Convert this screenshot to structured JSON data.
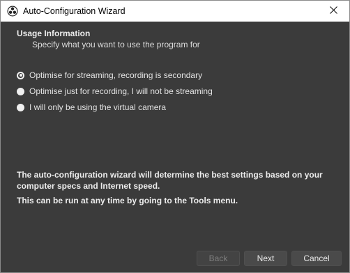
{
  "window": {
    "title": "Auto-Configuration Wizard",
    "icon": "obs-logo-icon",
    "close_icon": "close-icon"
  },
  "usage": {
    "title": "Usage Information",
    "subtitle": "Specify what you want to use the program for",
    "options": [
      {
        "label": "Optimise for streaming, recording is secondary",
        "selected": true
      },
      {
        "label": "Optimise just for recording, I will not be streaming",
        "selected": false
      },
      {
        "label": "I will only be using the virtual camera",
        "selected": false
      }
    ]
  },
  "info": {
    "line1": "The auto-configuration wizard will determine the best settings based on your computer specs and Internet speed.",
    "line2": "This can be run at any time by going to the Tools menu."
  },
  "buttons": {
    "back": {
      "label": "Back",
      "enabled": false
    },
    "next": {
      "label": "Next",
      "enabled": true
    },
    "cancel": {
      "label": "Cancel",
      "enabled": true
    }
  },
  "colors": {
    "background": "#3b3b3b",
    "titlebar": "#ffffff",
    "button": "#4a4a4a",
    "text": "#e6e6e6"
  }
}
